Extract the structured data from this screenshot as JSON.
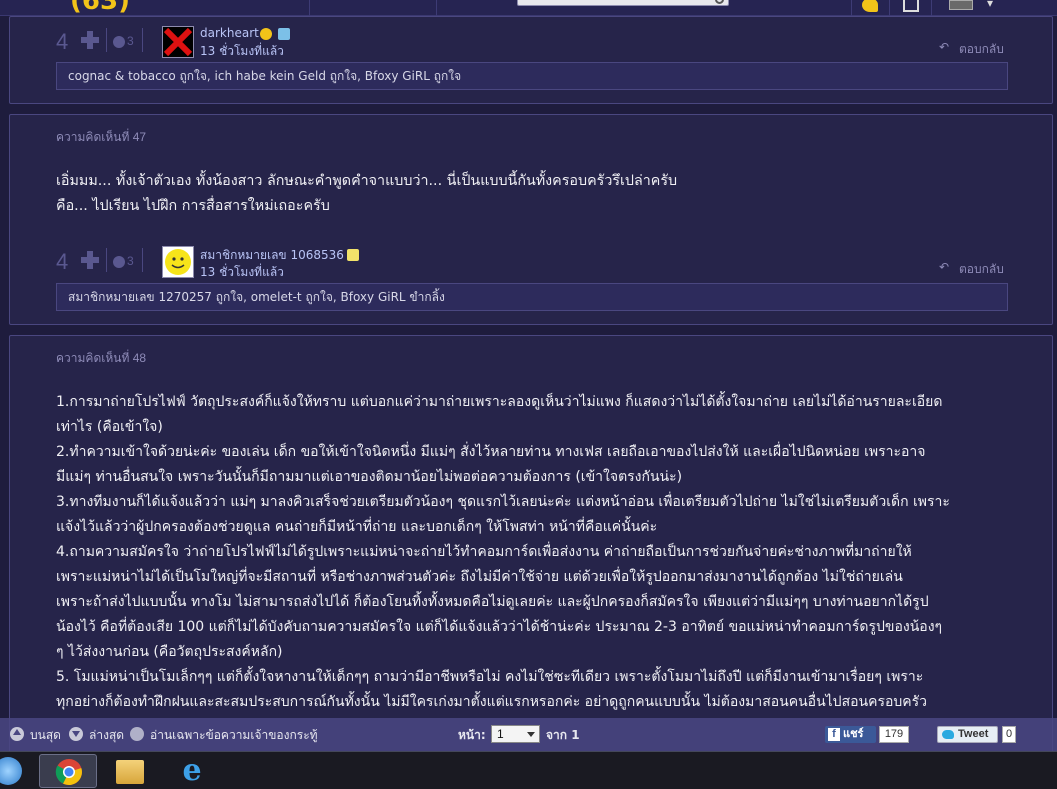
{
  "header": {
    "logo_text": "(63)",
    "search_placeholder": ""
  },
  "comments": [
    {
      "number_label": "",
      "body_lines": [],
      "votes": "4",
      "emotion_count": "3",
      "user": {
        "name": "darkheart",
        "time": "13 ชั่วโมงที่แล้ว"
      },
      "reply_label": "ตอบกลับ",
      "likes_text": "cognac & tobacco ถูกใจ, ich habe kein Geld ถูกใจ, Bfoxy GiRL ถูกใจ"
    },
    {
      "number_label": "ความคิดเห็นที่ 47",
      "body_lines": [
        "เอิ่มมม...  ทั้งเจ้าตัวเอง  ทั้งน้องสาว  ลักษณะคำพูดคำจาแบบว่า...  นี่เป็นแบบนี้กันทั้งครอบครัวรึเปล่าครับ",
        "คือ...  ไปเรียน  ไปฝึก  การสื่อสารใหม่เถอะครับ"
      ],
      "votes": "4",
      "emotion_count": "3",
      "user": {
        "name": "สมาชิกหมายเลข 1068536",
        "time": "13 ชั่วโมงที่แล้ว"
      },
      "reply_label": "ตอบกลับ",
      "likes_text": "สมาชิกหมายเลข 1270257 ถูกใจ, omelet-t ถูกใจ, Bfoxy GiRL ขำกลิ้ง"
    },
    {
      "number_label": "ความคิดเห็นที่ 48",
      "body_lines": [
        "1.การมาถ่ายโปรไฟฟ์ วัตถุประสงค์ก็แจ้งให้ทราบ แต่บอกแค่ว่ามาถ่ายเพราะลองดูเห็นว่าไม่แพง ก็แสดงว่าไม่ได้ตั้งใจมาถ่าย เลยไม่ได้อ่านรายละเอียด",
        "เท่าไร (คือเข้าใจ)",
        "2.ทำความเข้าใจด้วยน่ะค่ะ ของเล่น เด็ก ขอให้เข้าใจนิดหนึ่ง มีแม่ๆ สั่งไว้หลายท่าน ทางเฟส เลยถือเอาของไปส่งให้ และเผื่อไปนิดหน่อย เพราะอาจ",
        "มีแม่ๆ ท่านอื่นสนใจ เพราะวันนั้นก็มีถามมาแต่เอาของติดมาน้อยไม่พอต่อความต้องการ (เข้าใจตรงกันน่ะ)",
        "3.ทางทีมงานก็ได้แจ้งแล้วว่า แม่ๆ มาลงคิวเสร็จช่วยเตรียมตัวน้องๆ ชุดแรกไว้เลยน่ะค่ะ แต่งหน้าอ่อน เพื่อเตรียมตัวไปถ่าย ไม่ใช่ไม่เตรียมตัวเด็ก เพราะ",
        "แจ้งไว้แล้วว่าผู้ปกครองต้องช่วยดูแล คนถ่ายก็มีหน้าที่ถ่าย และบอกเด็กๆ ให้โพสท่า หน้าที่คือแค่นั้นค่ะ",
        "4.ถามความสมัครใจ ว่าถ่ายโปรไฟฟ์ไม่ได้รูปเพราะแม่หน่าจะถ่ายไว้ทำคอมการ์ดเพื่อส่งงาน ค่าถ่ายถือเป็นการช่วยกันจ่ายค่ะช่างภาพที่มาถ่ายให้",
        "เพราะแม่หน่าไม่ได้เป็นโมใหญ่ที่จะมีสถานที่ หรือช่างภาพส่วนตัวค่ะ ถึงไม่มีค่าใช้จ่าย แต่ด้วยเพื่อให้รูปออกมาส่งมางานได้ถูกต้อง ไม่ใช่ถ่ายเล่น",
        "เพราะถ้าส่งไปแบบนั้น ทางโม ไม่สามารถส่งไปได้ ก็ต้องโยนทิ้งทั้งหมดคือไม่ดูเลยค่ะ และผู้ปกครองก็สมัครใจ เพียงแต่ว่ามีแม่ๆๆ บางท่านอยากได้รูป",
        "น้องไว้ คือที่ต้องเสีย 100  แต่ก็ไม่ได้บังคับถามความสมัครใจ แต่ก็ได้แจ้งแล้วว่าได้ช้าน่ะค่ะ ประมาณ 2-3 อาทิตย์ ขอแม่หน่าทำคอมการ์ดรูปของน้องๆ",
        "ๆ ไว้ส่งงานก่อน (คือวัตถุประสงค์หลัก)",
        "5. โมแม่หน่าเป็นโมเล็กๆๆ แต่ก็ตั้งใจหางานให้เด็กๆๆ  ถามว่ามีอาชีพหรือไม่ คงไม่ใช่ซะทีเดียว เพราะตั้งโมมาไม่ถึงปี แต่ก็มีงานเข้ามาเรื่อยๆ เพราะ",
        "ทุกอย่างก็ต้องทำฝึกฝนและสะสมประสบการณ์กันทั้งนั้น ไม่มีใครเก่งมาตั้งแต่แรกหรอกค่ะ อย่าดูถูกคนแบบนั้น ไม่ต้องมาสอนคนอื่นไปสอนครอบครัว"
      ]
    }
  ],
  "bottom_toolbar": {
    "top_label": "บนสุด",
    "bottom_label": "ล่างสุด",
    "owner_only_label": "อ่านเฉพาะข้อความเจ้าของกระทู้",
    "page_label": "หน้า:",
    "page_value": "1",
    "of_label": "จาก 1",
    "fb_share_label": "แชร์",
    "fb_count": "179",
    "tweet_label": "Tweet",
    "tweet_count": "0"
  },
  "colors": {
    "background": "#1e1c3d",
    "card": "#26244a",
    "card_border": "#4a4780",
    "username": "#b9c4f6",
    "body_text": "#f0f0f4"
  }
}
